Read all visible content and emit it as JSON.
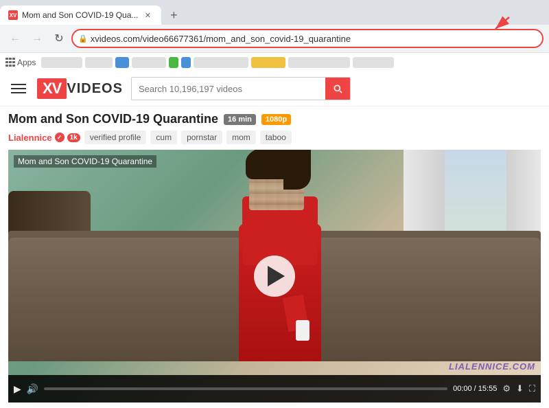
{
  "browser": {
    "tab": {
      "title": "Mom and Son COVID-19 Qua...",
      "favicon_label": "XV"
    },
    "new_tab_label": "+",
    "nav": {
      "back_label": "←",
      "forward_label": "→",
      "refresh_label": "↻"
    },
    "address": "xvideos.com/video66677361/mom_and_son_covid-19_quarantine",
    "bookmarks_label": "Apps"
  },
  "header": {
    "logo_icon": "XV",
    "logo_text": "VIDEOS",
    "search_placeholder": "Search 10,196,197 videos",
    "search_icon": "🔍"
  },
  "video": {
    "title": "Mom and Son COVID-19 Quarantine",
    "duration_badge": "16 min",
    "quality_badge": "1080p",
    "channel": "Lialennice",
    "verified_label": "✓",
    "subscribers_label": "1k",
    "tags": [
      "verified profile",
      "cum",
      "pornstar",
      "mom",
      "taboo"
    ],
    "overlay_title": "Mom and Son COVID-19 Quarantine",
    "watermark": "LIALENNICE.COM",
    "play_label": "▶",
    "controls": {
      "play": "▶",
      "volume": "🔊",
      "time": "00:00 / 15:55",
      "settings_icon": "⚙",
      "download_icon": "⬇",
      "fullscreen_icon": "⛶"
    }
  }
}
